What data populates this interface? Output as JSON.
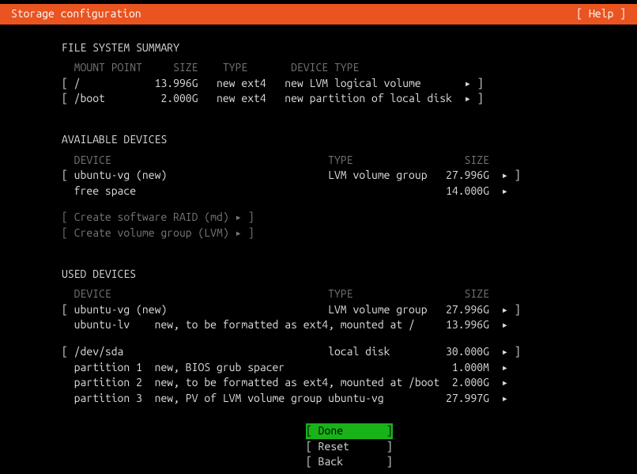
{
  "header": {
    "title": "Storage configuration",
    "help": "[ Help ]"
  },
  "fs_summary": {
    "title": "FILE SYSTEM SUMMARY",
    "cols": "  MOUNT POINT     SIZE    TYPE       DEVICE TYPE",
    "r1": "[ /            13.996G   new ext4   new LVM logical volume       ▸ ]",
    "r2": "[ /boot         2.000G   new ext4   new partition of local disk  ▸ ]"
  },
  "avail": {
    "title": "AVAILABLE DEVICES",
    "cols": "  DEVICE                                   TYPE                  SIZE",
    "r1": "[ ubuntu-vg (new)                          LVM volume group   27.996G  ▸ ]",
    "r2": "  free space                                                  14.000G  ▸",
    "a1": "[ Create software RAID (md) ▸ ]",
    "a2": "[ Create volume group (LVM) ▸ ]"
  },
  "used": {
    "title": "USED DEVICES",
    "cols": "  DEVICE                                   TYPE                  SIZE",
    "r1": "[ ubuntu-vg (new)                          LVM volume group   27.996G  ▸ ]",
    "r2": "  ubuntu-lv    new, to be formatted as ext4, mounted at /     13.996G  ▸",
    "r3": "[ /dev/sda                                 local disk         30.000G  ▸ ]",
    "r4": "  partition 1  new, BIOS grub spacer                           1.000M  ▸",
    "r5": "  partition 2  new, to be formatted as ext4, mounted at /boot  2.000G  ▸",
    "r6": "  partition 3  new, PV of LVM volume group ubuntu-vg          27.997G  ▸"
  },
  "footer": {
    "done": "[ Done       ]",
    "reset": "[ Reset      ]",
    "back": "[ Back       ]"
  }
}
